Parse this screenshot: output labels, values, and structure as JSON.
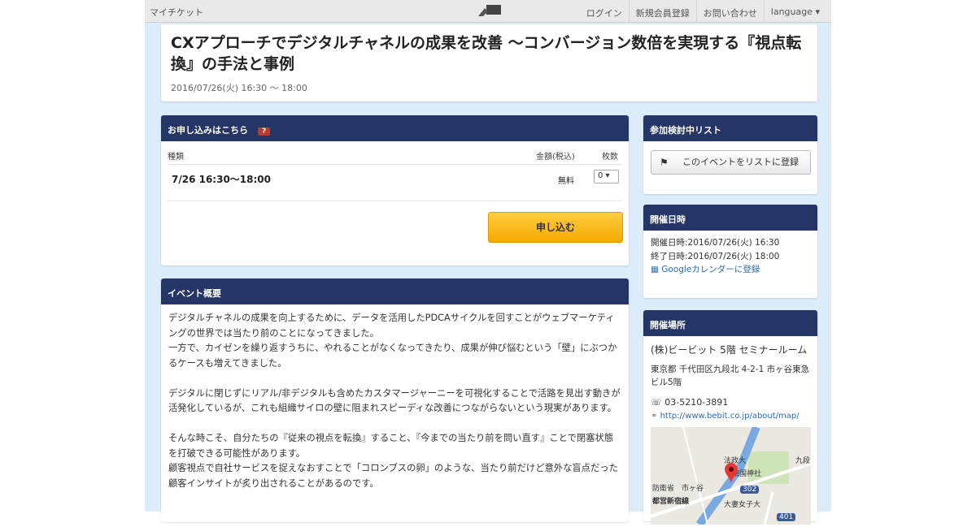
{
  "topbar": {
    "brand": "マイチケット",
    "nav": [
      "ログイン",
      "新規会員登録",
      "お問い合わせ",
      "language ▾"
    ]
  },
  "event": {
    "title": "CXアプローチでデジタルチャネルの成果を改善 ～コンバージョン数倍を実現する『視点転換』の手法と事例",
    "datetime": "2016/07/26(火) 16:30 ～ 18:00"
  },
  "apply": {
    "header": "お申し込みはこちら",
    "help": "?",
    "col_type": "種類",
    "col_price": "金額(税込)",
    "col_qty": "枚数",
    "ticket_name": "7/26 16:30～18:00",
    "ticket_price": "無料",
    "ticket_qty": "0 ▾",
    "button": "申し込む"
  },
  "overview": {
    "header": "イベント概要",
    "paragraphs": [
      "デジタルチャネルの成果を向上するために、データを活用したPDCAサイクルを回すことがウェブマーケティングの世界では当たり前のことになってきました。\n一方で、カイゼンを繰り返すうちに、やれることがなくなってきたり、成果が伸び悩むという「壁」にぶつかるケースも増えてきました。",
      "デジタルに閉じずにリアル/非デジタルも含めたカスタマージャーニーを可視化することで活路を見出す動きが活発化しているが、これも組織サイロの壁に阻まれスピーディな改善につながらないという現実があります。",
      "そんな時こそ、自分たちの『従来の視点を転換』すること、『今までの当たり前を問い直す』ことで閉塞状態を打破できる可能性があります。\n顧客視点で自社サービスを捉えなおすことで「コロンブスの卵」のような、当たり前だけど意外な盲点だった顧客インサイトが炙り出されることがあるのです。"
    ]
  },
  "watchlist": {
    "header": "参加検討中リスト",
    "button": "このイベントをリストに登録"
  },
  "dates": {
    "header": "開催日時",
    "start": "開催日時:2016/07/26(火) 16:30",
    "end": "終了日時:2016/07/26(火) 18:00",
    "gcal": "Googleカレンダーに登録"
  },
  "venue": {
    "header": "開催場所",
    "name": "(株)ビービット 5階 セミナールーム",
    "address": "東京都 千代田区九段北 4-2-1 市ヶ谷東急ビル5階",
    "tel": "03-5210-3891",
    "url": "http://www.bebit.co.jp/about/map/",
    "map_labels": [
      "法政大",
      "靖国神社",
      "市ヶ谷",
      "防衛省",
      "都営新宿線",
      "大妻女子大",
      "302",
      "401",
      "九段"
    ]
  },
  "colors": {
    "header_bg": "#243566",
    "page_bg": "#dcecfa",
    "button": "#f5a800"
  }
}
